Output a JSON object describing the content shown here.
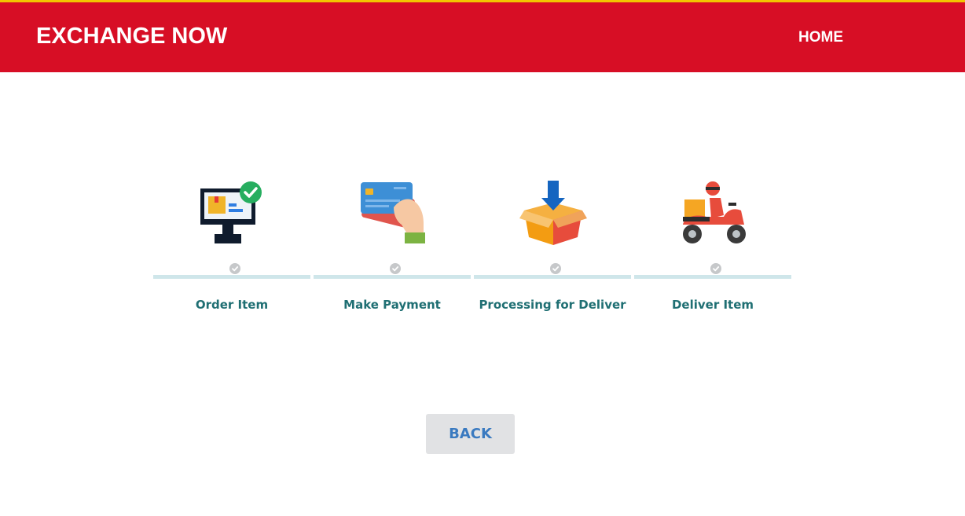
{
  "header": {
    "brand": "EXCHANGE NOW",
    "nav_home": "HOME"
  },
  "steps": [
    {
      "label": "Order Item",
      "icon": "computer-order-icon",
      "completed": true
    },
    {
      "label": "Make Payment",
      "icon": "credit-card-payment-icon",
      "completed": true
    },
    {
      "label": "Processing for Deliver",
      "icon": "package-box-icon",
      "completed": true
    },
    {
      "label": "Deliver Item",
      "icon": "delivery-scooter-icon",
      "completed": true
    }
  ],
  "actions": {
    "back_label": "BACK"
  },
  "colors": {
    "header_bg": "#d70e25",
    "header_accent": "#f2c500",
    "step_label": "#1f6f73",
    "progress_track": "#cfe6ea",
    "back_button_bg": "#e1e2e4",
    "back_button_text": "#3a7ac0"
  }
}
